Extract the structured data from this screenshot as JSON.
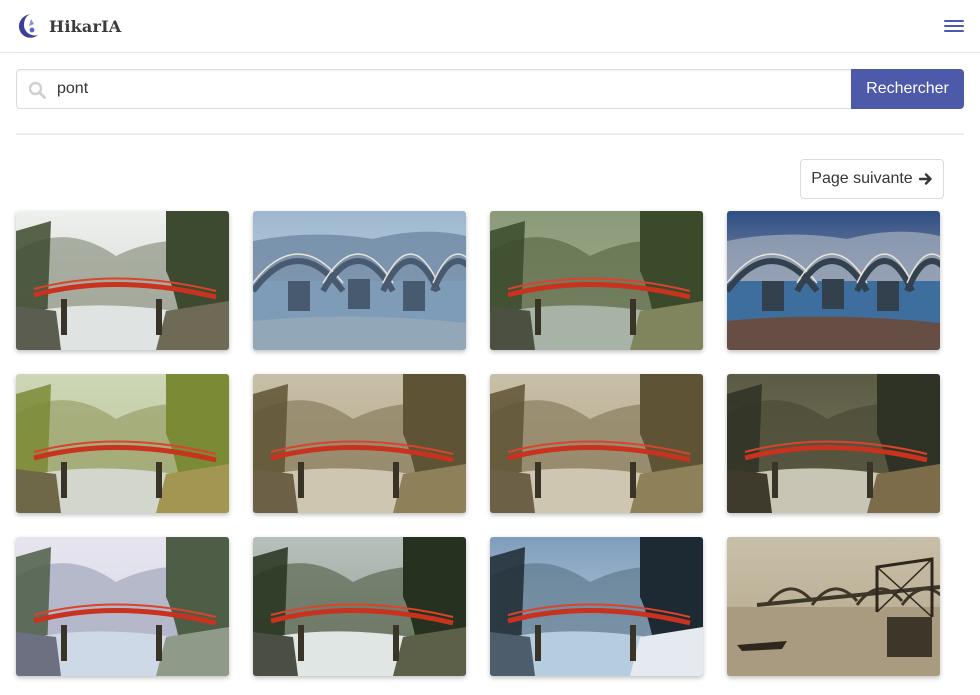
{
  "app": {
    "name": "HikarIA"
  },
  "icons": {
    "logo": "crescent-moon-logo",
    "menu": "hamburger-menu-icon",
    "search": "search-icon",
    "next": "arrow-right-icon"
  },
  "colors": {
    "accent": "#4c5aa9",
    "bridge_red": "#c8321e"
  },
  "search": {
    "value": "pont",
    "button_label": "Rechercher"
  },
  "pagination": {
    "next_label": "Page suivante"
  },
  "results": [
    {
      "kind": "red",
      "tone": "pale"
    },
    {
      "kind": "kintai",
      "tone": "blue"
    },
    {
      "kind": "red",
      "tone": "green"
    },
    {
      "kind": "kintai",
      "tone": "dusk"
    },
    {
      "kind": "red",
      "tone": "autumn"
    },
    {
      "kind": "red",
      "tone": "sepia"
    },
    {
      "kind": "red",
      "tone": "sepia"
    },
    {
      "kind": "red",
      "tone": "dark"
    },
    {
      "kind": "red",
      "tone": "pastel"
    },
    {
      "kind": "red",
      "tone": "forest"
    },
    {
      "kind": "red",
      "tone": "winter"
    },
    {
      "kind": "iron",
      "tone": "sepia"
    }
  ]
}
